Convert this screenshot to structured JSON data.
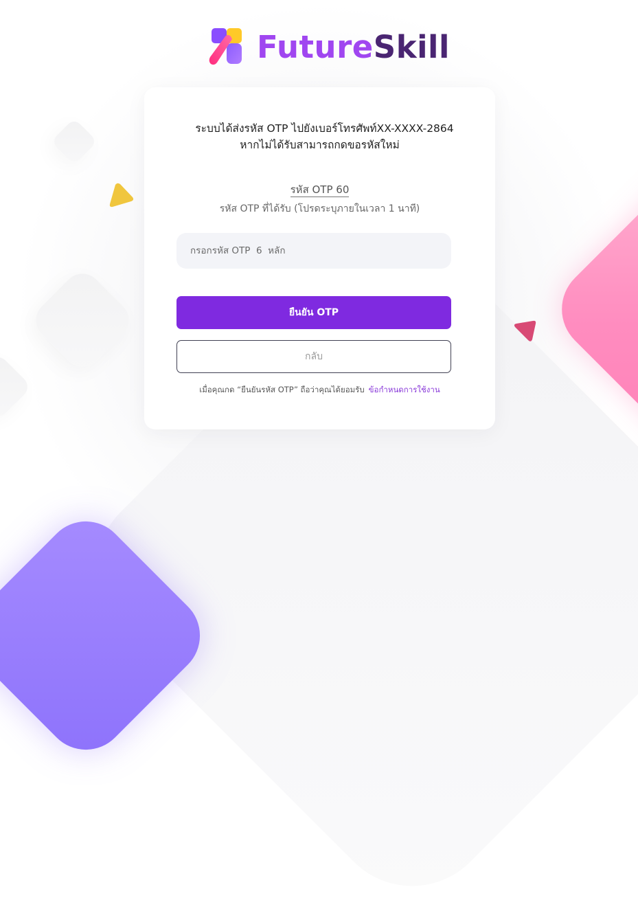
{
  "brand": {
    "name_part1": "Future",
    "name_part2": "Skill"
  },
  "otp_form": {
    "message_line1": "ระบบได้ส่งรหัส OTP ไปยังเบอร์โทรศัพท์XX-XXXX-2864",
    "message_line2": "หากไม่ได้รับสามารถกดขอรหัสใหม่",
    "timer_label": "รหัส OTP 60",
    "hint": "รหัส OTP ที่ได้รับ (โปรดระบุภายในเวลา 1 นาที)",
    "input_placeholder": "กรอกรหัส OTP  6  หลัก",
    "input_value": "",
    "confirm_button": "ยืนยัน OTP",
    "back_button": "กลับ",
    "terms_prefix": "เมื่อคุณกด “ยืนยันรหัส OTP” ถือว่าคุณได้ยอมรับ",
    "terms_link": "ข้อกำหนดการใช้งาน"
  },
  "colors": {
    "primary": "#7f2ae0",
    "brand_future": "#a046f0",
    "brand_skill": "#4a2572",
    "accent_pink": "#ff8cbf",
    "accent_purple": "#8d72fb",
    "accent_yellow": "#f0c63e",
    "accent_red": "#d84a75",
    "input_bg": "#f3f4f8"
  },
  "icons": {
    "logo": "futureskill-logo-icon"
  }
}
